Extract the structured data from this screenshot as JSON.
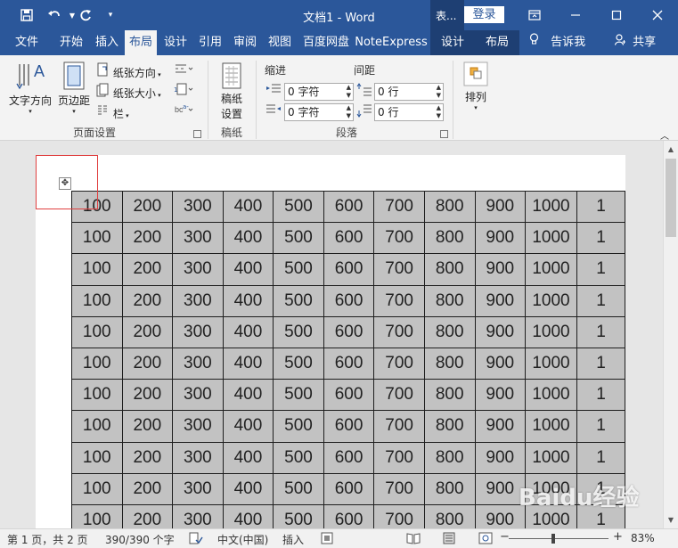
{
  "titlebar": {
    "title": "文档1 - Word",
    "ctx_group": "表...",
    "login": "登录",
    "save_icon": "save-icon",
    "undo_icon": "undo-icon",
    "redo_icon": "redo-icon",
    "customize_icon": "customize-icon"
  },
  "tabs": [
    {
      "label": "文件"
    },
    {
      "label": "开始"
    },
    {
      "label": "插入"
    },
    {
      "label": "布局"
    },
    {
      "label": "设计"
    },
    {
      "label": "引用"
    },
    {
      "label": "审阅"
    },
    {
      "label": "视图"
    },
    {
      "label": "百度网盘"
    },
    {
      "label": "NoteExpress"
    },
    {
      "label": "设计"
    },
    {
      "label": "布局"
    }
  ],
  "tellme": "告诉我",
  "share": "共享",
  "ribbon": {
    "text_direction": "文字方向",
    "margins": "页边距",
    "orientation": "纸张方向",
    "size": "纸张大小",
    "columns": "栏",
    "group_page_setup": "页面设置",
    "draft_paper_line1": "稿纸",
    "draft_paper_line2": "设置",
    "group_draft": "稿纸",
    "indent_label": "缩进",
    "spacing_label": "间距",
    "indent_left": "0 字符",
    "indent_right": "0 字符",
    "spacing_before": "0 行",
    "spacing_after": "0 行",
    "group_paragraph": "段落",
    "arrange": "排列"
  },
  "table": {
    "rows": [
      [
        "100",
        "200",
        "300",
        "400",
        "500",
        "600",
        "700",
        "800",
        "900",
        "1000",
        "1"
      ],
      [
        "100",
        "200",
        "300",
        "400",
        "500",
        "600",
        "700",
        "800",
        "900",
        "1000",
        "1"
      ],
      [
        "100",
        "200",
        "300",
        "400",
        "500",
        "600",
        "700",
        "800",
        "900",
        "1000",
        "1"
      ],
      [
        "100",
        "200",
        "300",
        "400",
        "500",
        "600",
        "700",
        "800",
        "900",
        "1000",
        "1"
      ],
      [
        "100",
        "200",
        "300",
        "400",
        "500",
        "600",
        "700",
        "800",
        "900",
        "1000",
        "1"
      ],
      [
        "100",
        "200",
        "300",
        "400",
        "500",
        "600",
        "700",
        "800",
        "900",
        "1000",
        "1"
      ],
      [
        "100",
        "200",
        "300",
        "400",
        "500",
        "600",
        "700",
        "800",
        "900",
        "1000",
        "1"
      ],
      [
        "100",
        "200",
        "300",
        "400",
        "500",
        "600",
        "700",
        "800",
        "900",
        "1000",
        "1"
      ],
      [
        "100",
        "200",
        "300",
        "400",
        "500",
        "600",
        "700",
        "800",
        "900",
        "1000",
        "1"
      ],
      [
        "100",
        "200",
        "300",
        "400",
        "500",
        "600",
        "700",
        "800",
        "900",
        "1000",
        "1"
      ],
      [
        "100",
        "200",
        "300",
        "400",
        "500",
        "600",
        "700",
        "800",
        "900",
        "1000",
        "1"
      ]
    ]
  },
  "status": {
    "page": "第 1 页，共 2 页",
    "words": "390/390 个字",
    "language": "中文(中国)",
    "mode": "插入",
    "zoom": "83%",
    "zoom_fraction": 0.45
  },
  "watermark": "Baidu经验",
  "colors": {
    "brand": "#2b579a",
    "context_tab": "#1e3f73",
    "cell_fill": "#c2c2c2",
    "selection_box": "#e04040"
  }
}
